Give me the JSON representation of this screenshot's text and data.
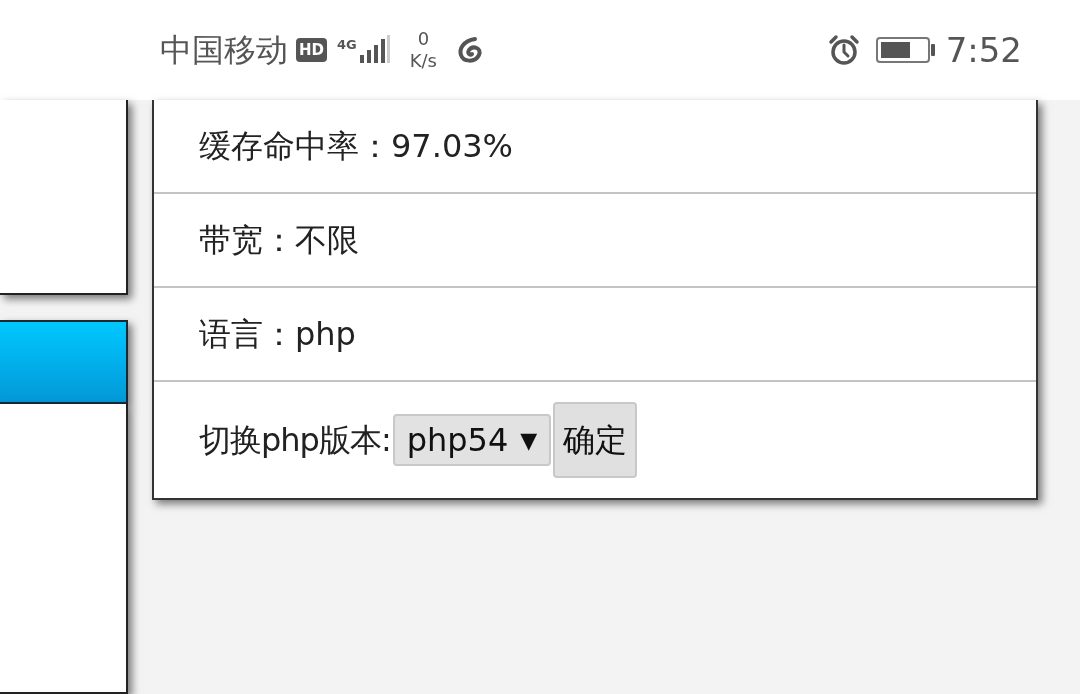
{
  "status_bar": {
    "carrier": "中国移动",
    "hd_badge": "HD",
    "network": "4G",
    "speed_value": "0",
    "speed_unit": "K/s",
    "time": "7:52"
  },
  "info_rows": [
    {
      "kind": "text",
      "text": "缓存命中率：97.03%"
    },
    {
      "kind": "text",
      "text": "带宽：不限"
    },
    {
      "kind": "text",
      "text": "语言：php"
    },
    {
      "kind": "form",
      "label": "切换php版本:",
      "select_value": "php54",
      "select_arrow": "▼",
      "button": "确定"
    }
  ]
}
